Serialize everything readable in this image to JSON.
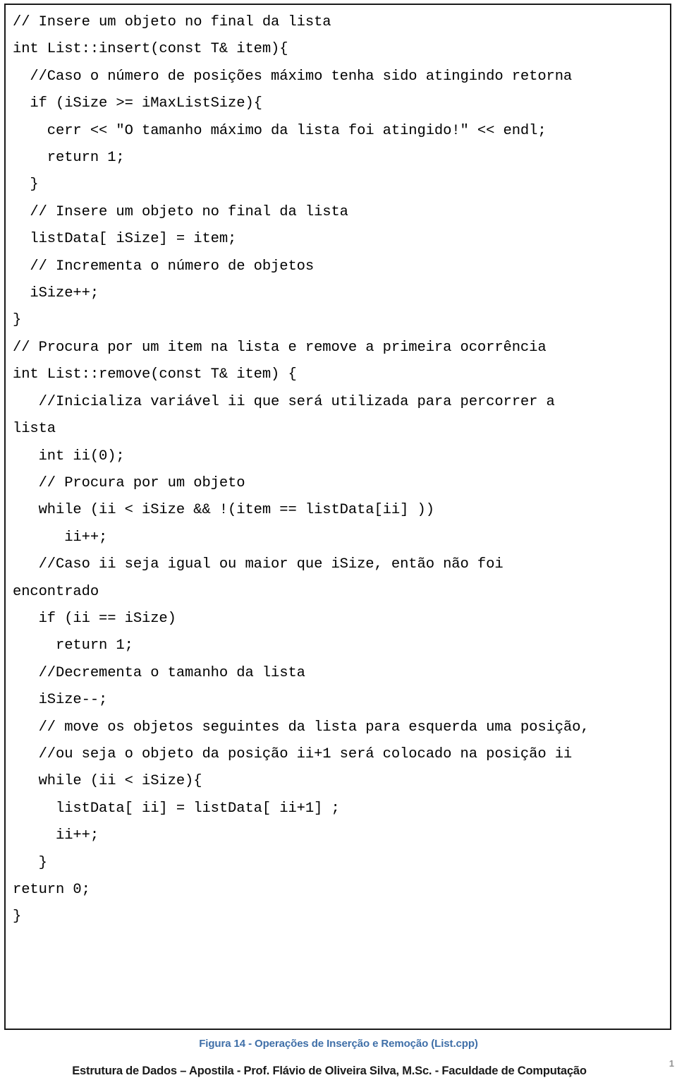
{
  "figure": {
    "caption": "Figura 14 - Operações de Inserção e Remoção (List.cpp)",
    "caption_color": "#3f6fa8",
    "border_color": "#1a1a1a",
    "language": "cpp",
    "code_lines": [
      "// Insere um objeto no final da lista",
      "int List::insert(const T& item){",
      "  //Caso o número de posições máximo tenha sido atingindo retorna",
      "  if (iSize >= iMaxListSize){",
      "    cerr << \"O tamanho máximo da lista foi atingido!\" << endl;",
      "    return 1;",
      "  }",
      "  // Insere um objeto no final da lista",
      "  listData[ iSize] = item;",
      "  // Incrementa o número de objetos",
      "  iSize++;",
      "}",
      "// Procura por um item na lista e remove a primeira ocorrência",
      "int List::remove(const T& item) {",
      "   //Inicializa variável ii que será utilizada para percorrer a",
      "lista",
      "   int ii(0);",
      "   // Procura por um objeto",
      "   while (ii < iSize && !(item == listData[ii] ))",
      "      ii++;",
      "   //Caso ii seja igual ou maior que iSize, então não foi",
      "encontrado",
      "   if (ii == iSize)",
      "     return 1;",
      "   //Decrementa o tamanho da lista",
      "   iSize--;",
      "   // move os objetos seguintes da lista para esquerda uma posição,",
      "   //ou seja o objeto da posição ii+1 será colocado na posição ii",
      "   while (ii < iSize){",
      "     listData[ ii] = listData[ ii+1] ;",
      "     ii++;",
      "   }",
      "return 0;",
      "}"
    ]
  },
  "footer": {
    "text": "Estrutura de Dados – Apostila - Prof. Flávio de Oliveira Silva, M.Sc. - Faculdade de Computação",
    "page_number": "1"
  }
}
